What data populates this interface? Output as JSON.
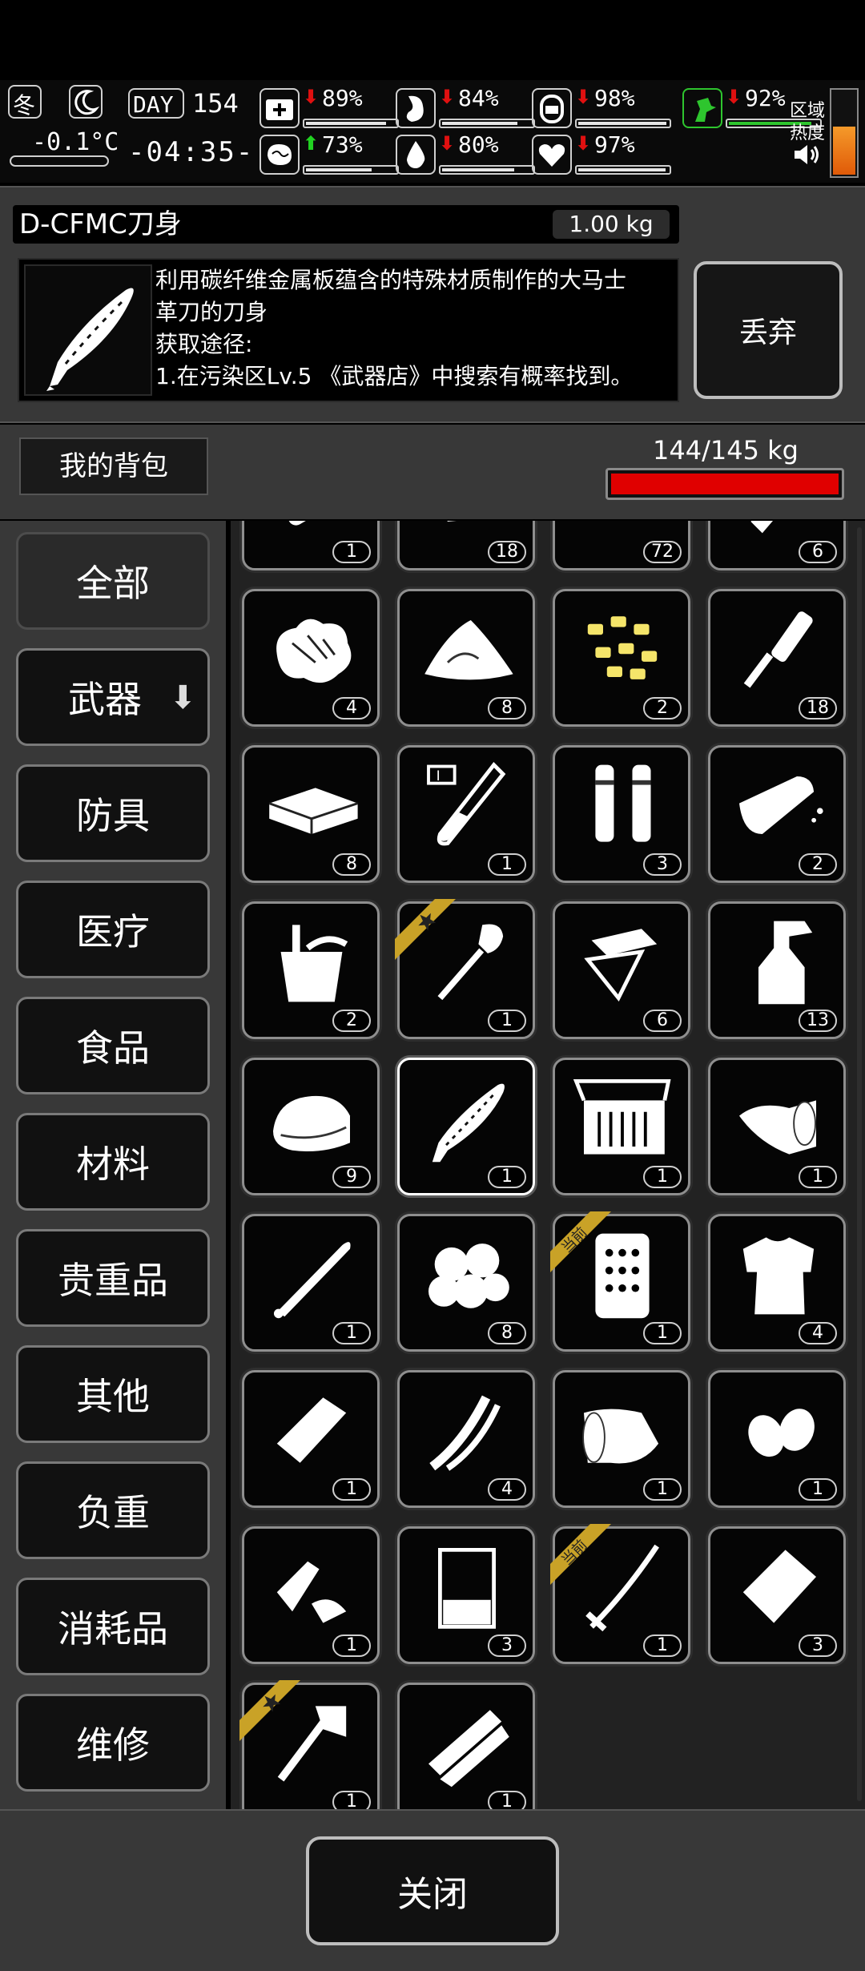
{
  "hud": {
    "season": "冬",
    "temperature": "-0.1°C",
    "day_label": "DAY",
    "day_number": "154",
    "time": "-04:35-",
    "stats": [
      {
        "name": "health",
        "icon": "first-aid-icon",
        "arrow": "down",
        "value": "89%",
        "level": 0.89
      },
      {
        "name": "hunger",
        "icon": "stomach-icon",
        "arrow": "down",
        "value": "84%",
        "level": 0.84
      },
      {
        "name": "oxygen",
        "icon": "mask-icon",
        "arrow": "down",
        "value": "98%",
        "level": 0.98
      },
      {
        "name": "mental",
        "icon": "brain-icon",
        "arrow": "up",
        "value": "73%",
        "level": 0.73
      },
      {
        "name": "thirst",
        "icon": "water-drop-icon",
        "arrow": "down",
        "value": "80%",
        "level": 0.8
      },
      {
        "name": "mood",
        "icon": "heart-icon",
        "arrow": "down",
        "value": "97%",
        "level": 0.97
      },
      {
        "name": "stamina",
        "icon": "running-icon",
        "arrow": "down",
        "value": "92%",
        "level": 0.92
      }
    ],
    "zone_heat_label_1": "区域",
    "zone_heat_label_2": "热度",
    "colors": {
      "down": "#e01010",
      "up": "#21d321",
      "stamina": "#2ec52e",
      "heat": "#f07a10"
    }
  },
  "detail": {
    "name": "D-CFMC刀身",
    "weight": "1.00 kg",
    "description": "利用碳纤维金属板蕴含的特殊材质制作的大马士\n革刀的刀身\n获取途径:\n1.在污染区Lv.5 《武器店》中搜索有概率找到。",
    "discard_label": "丢弃"
  },
  "bag": {
    "title": "我的背包",
    "weight": "144/145 kg",
    "fill": 0.993
  },
  "categories": [
    {
      "label": "全部",
      "active": true
    },
    {
      "label": "武器",
      "has_arrow": true
    },
    {
      "label": "防具"
    },
    {
      "label": "医疗"
    },
    {
      "label": "食品"
    },
    {
      "label": "材料"
    },
    {
      "label": "贵重品"
    },
    {
      "label": "其他"
    },
    {
      "label": "负重"
    },
    {
      "label": "消耗品"
    },
    {
      "label": "维修"
    }
  ],
  "items": [
    {
      "icon": "bandage-icon",
      "count": "1"
    },
    {
      "icon": "scrap-icon",
      "count": "18"
    },
    {
      "icon": "rubble-icon",
      "count": "72"
    },
    {
      "icon": "tool-icon",
      "count": "6"
    },
    {
      "icon": "cotton-icon",
      "count": "4"
    },
    {
      "icon": "powder-pile-icon",
      "count": "8"
    },
    {
      "icon": "yellow-pills-icon",
      "count": "2"
    },
    {
      "icon": "syringe-brush-icon",
      "count": "18"
    },
    {
      "icon": "money-stack-icon",
      "count": "8"
    },
    {
      "icon": "test-tube-icon",
      "count": "1"
    },
    {
      "icon": "two-vials-icon",
      "count": "3"
    },
    {
      "icon": "bread-icon",
      "count": "2"
    },
    {
      "icon": "bucket-icon",
      "count": "2"
    },
    {
      "icon": "shovel-icon",
      "count": "1",
      "tag": "star"
    },
    {
      "icon": "papers-icon",
      "count": "6"
    },
    {
      "icon": "spray-bottle-icon",
      "count": "13"
    },
    {
      "icon": "towel-icon",
      "count": "9"
    },
    {
      "icon": "blade-icon",
      "count": "1",
      "selected": true
    },
    {
      "icon": "crate-icon",
      "count": "1"
    },
    {
      "icon": "tape-roll-icon",
      "count": "1"
    },
    {
      "icon": "baseball-bat-icon",
      "count": "1"
    },
    {
      "icon": "cotton-balls-icon",
      "count": "8"
    },
    {
      "icon": "grater-icon",
      "count": "1",
      "tag": "当前"
    },
    {
      "icon": "torn-shirt-icon",
      "count": "4"
    },
    {
      "icon": "milk-carton-icon",
      "count": "1"
    },
    {
      "icon": "leek-icon",
      "count": "4"
    },
    {
      "icon": "cloth-roll-icon",
      "count": "1"
    },
    {
      "icon": "eggs-icon",
      "count": "1"
    },
    {
      "icon": "plastic-bottle-icon",
      "count": "1"
    },
    {
      "icon": "beaker-icon",
      "count": "3"
    },
    {
      "icon": "katana-icon",
      "count": "1",
      "tag": "当前"
    },
    {
      "icon": "paper-bag-icon",
      "count": "3"
    },
    {
      "icon": "hatchet-icon",
      "count": "1",
      "tag": "star"
    },
    {
      "icon": "pipes-icon",
      "count": "1"
    }
  ],
  "tag_color": "#c9a227",
  "footer": {
    "close_label": "关闭"
  }
}
